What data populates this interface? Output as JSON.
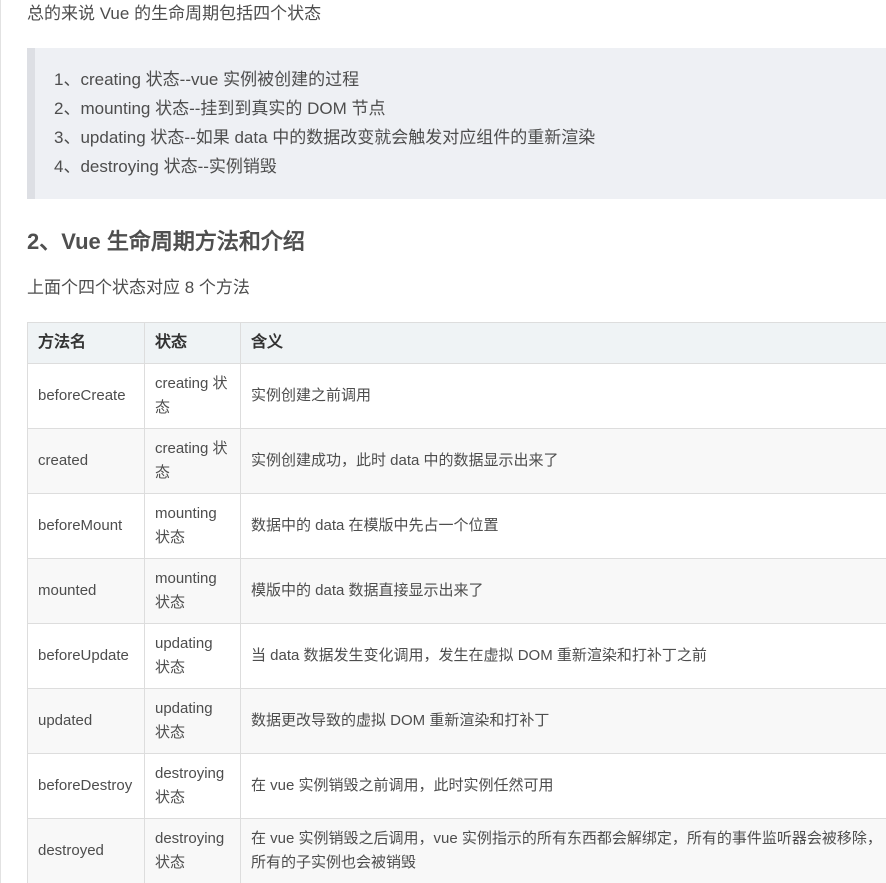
{
  "intro": "总的来说 Vue 的生命周期包括四个状态",
  "quote": [
    "1、creating 状态--vue 实例被创建的过程",
    "2、mounting 状态--挂到到真实的 DOM 节点",
    "3、updating 状态--如果 data 中的数据改变就会触发对应组件的重新渲染",
    "4、destroying 状态--实例销毁"
  ],
  "section_title": "2、Vue 生命周期方法和介绍",
  "sub_intro": "上面个四个状态对应 8 个方法",
  "table": {
    "headers": [
      "方法名",
      "状态",
      "含义"
    ],
    "rows": [
      [
        "beforeCreate",
        "creating 状态",
        "实例创建之前调用"
      ],
      [
        "created",
        "creating 状态",
        "实例创建成功，此时 data 中的数据显示出来了"
      ],
      [
        "beforeMount",
        "mounting 状态",
        "数据中的 data 在模版中先占一个位置"
      ],
      [
        "mounted",
        "mounting 状态",
        "模版中的 data 数据直接显示出来了"
      ],
      [
        "beforeUpdate",
        "updating 状态",
        "当 data 数据发生变化调用，发生在虚拟 DOM 重新渲染和打补丁之前"
      ],
      [
        "updated",
        "updating 状态",
        "数据更改导致的虚拟 DOM 重新渲染和打补丁"
      ],
      [
        "beforeDestroy",
        "destroying 状态",
        "在 vue 实例销毁之前调用，此时实例任然可用"
      ],
      [
        "destroyed",
        "destroying 状态",
        "在 vue 实例销毁之后调用，vue 实例指示的所有东西都会解绑定，所有的事件监听器会被移除，所有的子实例也会被销毁"
      ]
    ]
  }
}
